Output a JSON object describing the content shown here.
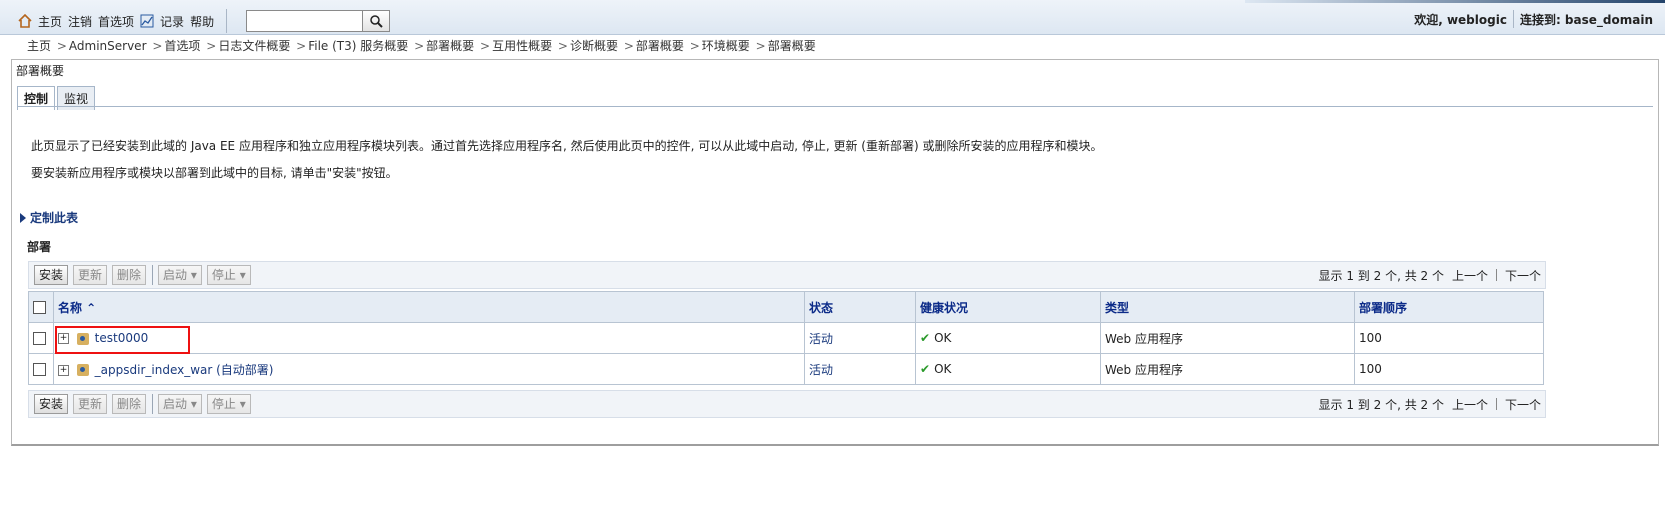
{
  "nav": {
    "home": "主页",
    "logout": "注销",
    "prefs": "首选项",
    "record": "记录",
    "help": "帮助",
    "search_value": "",
    "welcome_label": "欢迎, weblogic",
    "connected_label": "连接到: base_domain"
  },
  "breadcrumb": [
    "主页",
    "AdminServer",
    "首选项",
    "日志文件概要",
    "File (T3) 服务概要",
    "部署概要",
    "互用性概要",
    "诊断概要",
    "部署概要",
    "环境概要",
    "部署概要"
  ],
  "panel": {
    "title": "部署概要",
    "tabs": [
      "控制",
      "监视"
    ]
  },
  "text": {
    "desc1": "此页显示了已经安装到此域的 Java EE 应用程序和独立应用程序模块列表。通过首先选择应用程序名, 然后使用此页中的控件, 可以从此域中启动, 停止, 更新 (重新部署) 或删除所安装的应用程序和模块。",
    "desc2": "要安装新应用程序或模块以部署到此域中的目标, 请单击\"安装\"按钮。",
    "customize": "定制此表",
    "section": "部署"
  },
  "toolbar": {
    "install": "安装",
    "update": "更新",
    "delete": "删除",
    "start": "启动 ▾",
    "stop": "停止 ▾",
    "pager": "显示 1 到 2 个, 共 2 个",
    "prev": "上一个",
    "next": "下一个"
  },
  "table": {
    "headers": [
      "名称 ⌃",
      "状态",
      "健康状况",
      "类型",
      "部署顺序"
    ],
    "rows": [
      {
        "name": "test0000",
        "state": "活动",
        "health": "OK",
        "type": "Web 应用程序",
        "order": "100"
      },
      {
        "name": "_appsdir_index_war (自动部署)",
        "state": "活动",
        "health": "OK",
        "type": "Web 应用程序",
        "order": "100"
      }
    ]
  },
  "colors": {
    "accent": "#1a3a7d",
    "header_bg": "#e5ecf4",
    "highlight": "#e11"
  }
}
